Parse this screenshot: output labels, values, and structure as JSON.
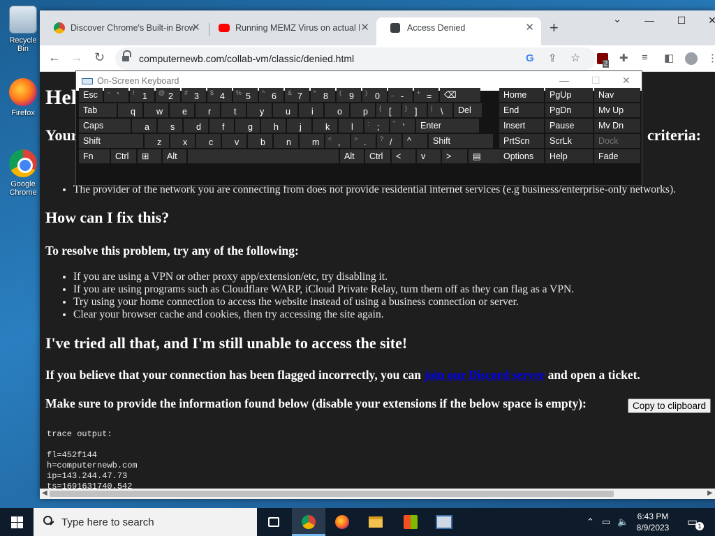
{
  "desktop": {
    "icons": [
      {
        "label": "Recycle Bin"
      },
      {
        "label": "Firefox"
      },
      {
        "label": "Google Chrome"
      }
    ]
  },
  "browser": {
    "tabs": [
      {
        "title": "Discover Chrome's Built-in Brow",
        "icon": "chrome-icon"
      },
      {
        "title": "Running MEMZ Virus on actual h",
        "icon": "youtube-icon"
      },
      {
        "title": "Access Denied",
        "icon": "cloudflare-icon",
        "active": true
      }
    ],
    "url": "computernewb.com/collab-vm/classic/denied.html",
    "extension_badge": "2"
  },
  "keyboard": {
    "title": "On-Screen Keyboard",
    "rows": [
      [
        {
          "k": "Esc"
        },
        {
          "s": "~",
          "m": "`"
        },
        {
          "s": "!",
          "m": "1"
        },
        {
          "s": "@",
          "m": "2"
        },
        {
          "s": "#",
          "m": "3"
        },
        {
          "s": "$",
          "m": "4"
        },
        {
          "s": "%",
          "m": "5"
        },
        {
          "s": "^",
          "m": "6"
        },
        {
          "s": "&",
          "m": "7"
        },
        {
          "s": "*",
          "m": "8"
        },
        {
          "s": "(",
          "m": "9"
        },
        {
          "s": ")",
          "m": "0"
        },
        {
          "s": "_",
          "m": "-"
        },
        {
          "s": "+",
          "m": "="
        },
        {
          "k": "⌫"
        }
      ],
      [
        {
          "k": "Tab"
        },
        {
          "m": "q"
        },
        {
          "m": "w"
        },
        {
          "m": "e"
        },
        {
          "m": "r"
        },
        {
          "m": "t"
        },
        {
          "m": "y"
        },
        {
          "m": "u"
        },
        {
          "m": "i"
        },
        {
          "m": "o"
        },
        {
          "m": "p"
        },
        {
          "s": "{",
          "m": "["
        },
        {
          "s": "}",
          "m": "]"
        },
        {
          "s": "|",
          "m": "\\"
        },
        {
          "k": "Del"
        }
      ],
      [
        {
          "k": "Caps"
        },
        {
          "m": "a"
        },
        {
          "m": "s"
        },
        {
          "m": "d"
        },
        {
          "m": "f"
        },
        {
          "m": "g"
        },
        {
          "m": "h"
        },
        {
          "m": "j"
        },
        {
          "m": "k"
        },
        {
          "m": "l"
        },
        {
          "s": ":",
          "m": ";"
        },
        {
          "s": "\"",
          "m": "'"
        },
        {
          "k": "Enter"
        }
      ],
      [
        {
          "k": "Shift"
        },
        {
          "m": "z"
        },
        {
          "m": "x"
        },
        {
          "m": "c"
        },
        {
          "m": "v"
        },
        {
          "m": "b"
        },
        {
          "m": "n"
        },
        {
          "m": "m"
        },
        {
          "s": "<",
          "m": ","
        },
        {
          "s": ">",
          "m": "."
        },
        {
          "s": "?",
          "m": "/"
        },
        {
          "k": "^"
        },
        {
          "k": "Shift"
        }
      ],
      [
        {
          "k": "Fn"
        },
        {
          "k": "Ctrl"
        },
        {
          "k": "⊞"
        },
        {
          "k": "Alt"
        },
        {
          "k": ""
        },
        {
          "k": "Alt"
        },
        {
          "k": "Ctrl"
        },
        {
          "k": "<"
        },
        {
          "k": "v"
        },
        {
          "k": ">"
        },
        {
          "k": "▤"
        }
      ]
    ],
    "nav_keys": [
      [
        "Home",
        "PgUp",
        "Nav"
      ],
      [
        "End",
        "PgDn",
        "Mv Up"
      ],
      [
        "Insert",
        "Pause",
        "Mv Dn"
      ],
      [
        "PrtScn",
        "ScrLk",
        "Dock"
      ],
      [
        "Options",
        "Help",
        "Fade"
      ]
    ]
  },
  "page": {
    "heading_partial": "Hel",
    "your_partial": "Your",
    "criteria_partial": "criteria:",
    "bullets_top": [
      "The provider of the network you are connecting from does not provide residential internet services (e.g business/enterprise-only networks)."
    ],
    "fix_heading": "How can I fix this?",
    "resolve_heading": "To resolve this problem, try any of the following:",
    "fix_items": [
      "If you are using a VPN or other proxy app/extension/etc, try disabling it.",
      "If you are using programs such as Cloudflare WARP, iCloud Private Relay, turn them off as they can flag as a VPN.",
      "Try using your home connection to access the website instead of using a business connection or server.",
      "Clear your browser cache and cookies, then try accessing the site again."
    ],
    "still_heading": "I've tried all that, and I'm still unable to access the site!",
    "flagged_pre": "If you believe that your connection has been flagged incorrectly, you can ",
    "flagged_link": "join our Discord server",
    "flagged_post": " and open a ticket.",
    "provide_text": "Make sure to provide the information found below (disable your extensions if the below space is empty):",
    "copy_button": "Copy to clipboard",
    "trace": "trace output:\n\nfl=452f144\nh=computernewb.com\nip=143.244.47.73\nts=1691631740.542"
  },
  "taskbar": {
    "search_placeholder": "Type here to search",
    "time": "6:43 PM",
    "date": "8/9/2023",
    "notification_count": "1"
  }
}
